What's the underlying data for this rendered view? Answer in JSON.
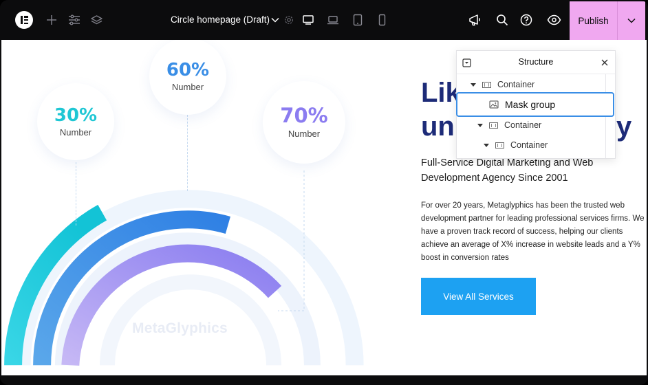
{
  "topbar": {
    "doc_title": "Circle homepage (Draft)",
    "publish_label": "Publish",
    "icons": [
      "elementor-logo-icon",
      "add-icon",
      "site-settings-icon",
      "layers-icon",
      "chevron-down-icon",
      "page-settings-icon",
      "desktop-icon",
      "laptop-icon",
      "tablet-icon",
      "mobile-icon",
      "announcements-icon",
      "search-icon",
      "help-icon",
      "preview-icon",
      "chevron-down-icon"
    ]
  },
  "stats": [
    {
      "value": "30%",
      "label": "Number",
      "color": "#1fc7d4"
    },
    {
      "value": "60%",
      "label": "Number",
      "color": "#3a8ee6"
    },
    {
      "value": "70%",
      "label": "Number",
      "color": "#8b7cf0"
    }
  ],
  "watermark": "MetaGlyphics",
  "hero": {
    "title_line1": "Like",
    "title_line2": "unl",
    "title_line2_end": "y",
    "subtitle": "Full-Service Digital Marketing and Web Development Agency Since 2001",
    "body": "For over 20 years, Metaglyphics has been the trusted web development partner for leading professional services firms. We have a proven track record of success, helping our clients achieve an average of X% increase in website leads and a Y% boost in conversion rates",
    "cta_label": "View All Services"
  },
  "structure_panel": {
    "title": "Structure",
    "items": [
      {
        "label": "Container",
        "kind": "container"
      },
      {
        "label": "Mask group",
        "kind": "image",
        "selected": true
      },
      {
        "label": "Container",
        "kind": "container"
      },
      {
        "label": "Container",
        "kind": "container"
      }
    ]
  },
  "colors": {
    "accent_pink": "#f0a8f0",
    "brand_navy": "#1d2b78",
    "cta_blue": "#1da1f2",
    "selection_blue": "#3a8ee6"
  }
}
